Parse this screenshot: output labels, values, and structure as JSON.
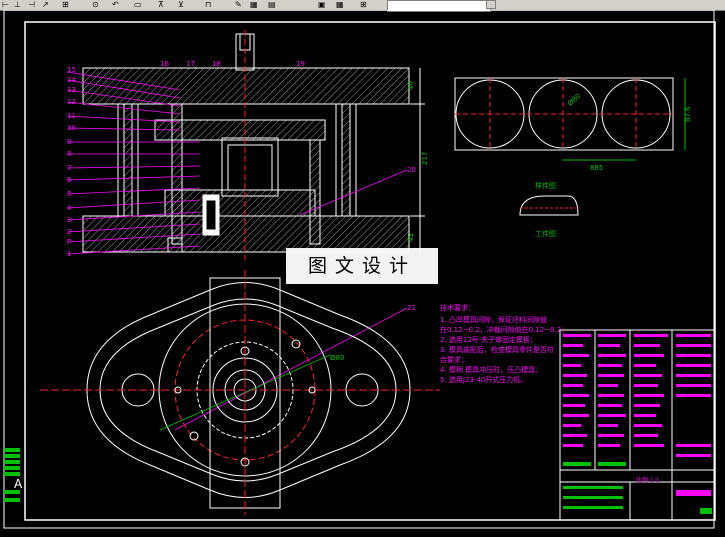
{
  "toolbar": {
    "icons": [
      "ortho-icon",
      "snap-icon",
      "grid-icon",
      "polar-icon",
      "osnap-icon",
      "otrack-icon",
      "layer-icon",
      "properties-icon",
      "table-icon",
      "table2-icon"
    ],
    "search_value": ""
  },
  "drawing": {
    "part_labels_left": [
      "15",
      "14",
      "13",
      "12",
      "11",
      "10",
      "9",
      "8",
      "7",
      "6",
      "5",
      "4",
      "3",
      "2",
      "P",
      "1"
    ],
    "part_labels_top": [
      "16",
      "17",
      "18",
      "19"
    ],
    "label_20": "20",
    "label_21": "21",
    "dim_right_40": "40",
    "dim_right_217": "217",
    "dim_right_45": "45",
    "dim_plan_width": "885",
    "dim_plan_height": "87.6",
    "dim_plan_diag": "Ø80",
    "dim_big_dia": "Ø80",
    "small_view_label1": "样件图",
    "small_view_label2": "工件图",
    "tech_title": "技术要求：",
    "tech_notes": [
      "1. 凸凹模具间隙，保证坯料间隙值",
      "   在0.12~0.2，冲裁间隙值在0.12~0.2；",
      "2. 选用12号 夹子做固定模板；",
      "3. 模具装配后，检查模具零件是否符",
      "   合要求；",
      "4. 模柄 模具冲压时，压凸模具；",
      "5. 选用J23-40开式压力机。"
    ],
    "title_block_scale": "比例 1:1",
    "left_strip_label": "A"
  },
  "watermark": "图文设计",
  "colors": {
    "background": "#000000",
    "lines": "#ffffff",
    "magenta": "#ff00ff",
    "green": "#00c000",
    "hatch": "#bfbfbf",
    "center": "#ff2020"
  }
}
